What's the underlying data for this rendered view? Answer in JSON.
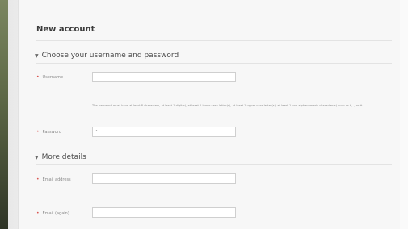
{
  "page": {
    "title": "New account"
  },
  "sections": {
    "credentials": {
      "heading": "Choose your username and password",
      "username_label": "Username",
      "username_value": "",
      "password_hint": "The password must have at least 8 characters, at least 1 digit(s), at least 1 lower case letter(s), at least 1 upper case letter(s), at least 1 non-alphanumeric character(s) such as *, -, or #",
      "password_label": "Password",
      "password_value": "•"
    },
    "details": {
      "heading": "More details",
      "email_label": "Email address",
      "email_value": "",
      "email_again_label": "Email (again)",
      "email_again_value": ""
    }
  },
  "icons": {
    "section_toggle": "chevron-down-icon",
    "required": "required-icon"
  },
  "colors": {
    "required": "#d9534f",
    "text": "#3b3b3b",
    "muted": "#8a8a8a"
  }
}
